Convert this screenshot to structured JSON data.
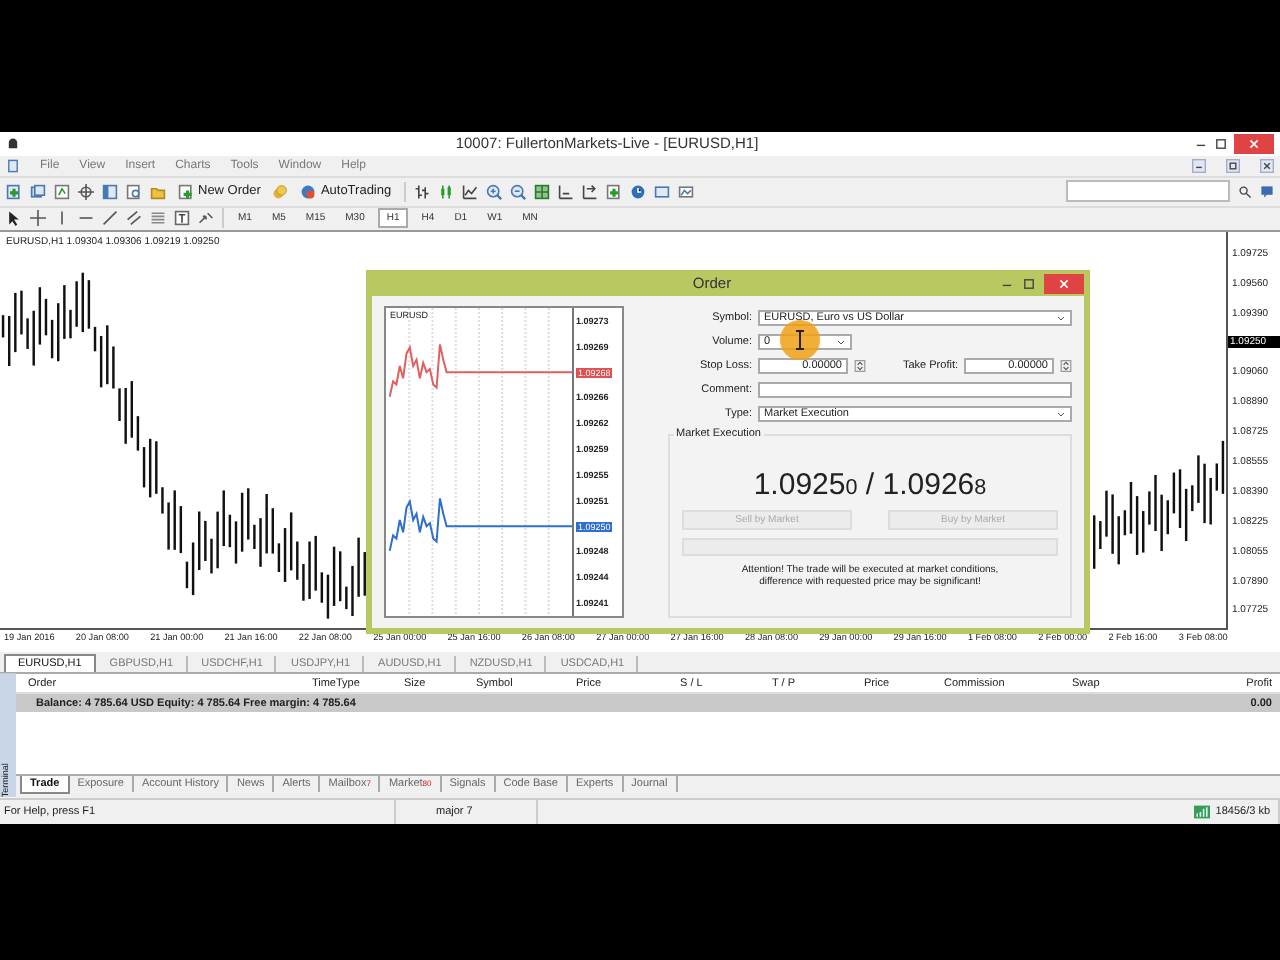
{
  "window": {
    "title": "10007: FullertonMarkets-Live - [EURUSD,H1]"
  },
  "menu": [
    "File",
    "View",
    "Insert",
    "Charts",
    "Tools",
    "Window",
    "Help"
  ],
  "toolbar": {
    "new_order": "New Order",
    "auto_trading": "AutoTrading"
  },
  "timeframes": [
    {
      "label": "M1",
      "selected": false
    },
    {
      "label": "M5",
      "selected": false
    },
    {
      "label": "M15",
      "selected": false
    },
    {
      "label": "M30",
      "selected": false
    },
    {
      "label": "H1",
      "selected": true
    },
    {
      "label": "H4",
      "selected": false
    },
    {
      "label": "D1",
      "selected": false
    },
    {
      "label": "W1",
      "selected": false
    },
    {
      "label": "MN",
      "selected": false
    }
  ],
  "chart": {
    "title": "EURUSD,H1  1.09304 1.09306 1.09219 1.09250",
    "price_labels": [
      {
        "text": "1.09725",
        "kind": "grid"
      },
      {
        "text": "1.09560",
        "kind": "grid"
      },
      {
        "text": "1.09390",
        "kind": "grid"
      },
      {
        "text": "1.09250",
        "kind": "current"
      },
      {
        "text": "1.09060",
        "kind": "grid"
      },
      {
        "text": "1.08890",
        "kind": "grid"
      },
      {
        "text": "1.08725",
        "kind": "grid"
      },
      {
        "text": "1.08555",
        "kind": "grid"
      },
      {
        "text": "1.08390",
        "kind": "grid"
      },
      {
        "text": "1.08225",
        "kind": "grid"
      },
      {
        "text": "1.08055",
        "kind": "grid"
      },
      {
        "text": "1.07890",
        "kind": "grid"
      },
      {
        "text": "1.07725",
        "kind": "grid"
      }
    ],
    "time_labels": [
      "19 Jan 2016",
      "20 Jan 08:00",
      "21 Jan 00:00",
      "21 Jan 16:00",
      "22 Jan 08:00",
      "25 Jan 00:00",
      "25 Jan 16:00",
      "26 Jan 08:00",
      "27 Jan 00:00",
      "27 Jan 16:00",
      "28 Jan 08:00",
      "29 Jan 00:00",
      "29 Jan 16:00",
      "1 Feb 08:00",
      "2 Feb 00:00",
      "2 Feb 16:00",
      "3 Feb 08:00"
    ]
  },
  "chart_tabs": [
    {
      "label": "EURUSD,H1",
      "selected": true
    },
    {
      "label": "GBPUSD,H1",
      "selected": false
    },
    {
      "label": "USDCHF,H1",
      "selected": false
    },
    {
      "label": "USDJPY,H1",
      "selected": false
    },
    {
      "label": "AUDUSD,H1",
      "selected": false
    },
    {
      "label": "NZDUSD,H1",
      "selected": false
    },
    {
      "label": "USDCAD,H1",
      "selected": false
    }
  ],
  "order_dialog": {
    "title": "Order",
    "tick_chart": {
      "symbol": "EURUSD",
      "price_labels": [
        {
          "text": "1.09273",
          "kind": "tick"
        },
        {
          "text": "1.09269",
          "kind": "tick"
        },
        {
          "text": "1.09268",
          "kind": "ask"
        },
        {
          "text": "1.09266",
          "kind": "tick"
        },
        {
          "text": "1.09262",
          "kind": "tick"
        },
        {
          "text": "1.09259",
          "kind": "tick"
        },
        {
          "text": "1.09255",
          "kind": "tick"
        },
        {
          "text": "1.09251",
          "kind": "tick"
        },
        {
          "text": "1.09250",
          "kind": "bid"
        },
        {
          "text": "1.09248",
          "kind": "tick"
        },
        {
          "text": "1.09244",
          "kind": "tick"
        },
        {
          "text": "1.09241",
          "kind": "tick"
        }
      ]
    },
    "symbol": {
      "label": "Symbol:",
      "value": "EURUSD, Euro vs US Dollar"
    },
    "volume": {
      "label": "Volume:",
      "value": "0"
    },
    "stop_loss": {
      "label": "Stop Loss:",
      "value": "0.00000"
    },
    "take_profit": {
      "label": "Take Profit:",
      "value": "0.00000"
    },
    "comment": {
      "label": "Comment:"
    },
    "type": {
      "label": "Type:",
      "value": "Market Execution"
    },
    "group_title": "Market Execution",
    "quote": "1.0925$_{0}$ / 1.0926$_{8}$",
    "buttons": [
      {
        "label": "Sell by Market",
        "disabled": true
      },
      {
        "label": "Buy by Market",
        "disabled": true
      }
    ],
    "notice": "Attention! The trade will be executed at market conditions, difference with requested price may be significant!"
  },
  "terminal": {
    "side_label": "Terminal",
    "columns": [
      "Order",
      "Time",
      "Type",
      "Size",
      "Symbol",
      "Price",
      "S / L",
      "T / P",
      "Price",
      "Commission",
      "Swap",
      "Profit"
    ],
    "balance": "Balance: 4 785.64 USD  Equity: 4 785.64  Free margin: 4 785.64",
    "profit": "0.00",
    "tabs": [
      {
        "label": "Trade",
        "selected": true
      },
      {
        "label": "Exposure",
        "selected": false
      },
      {
        "label": "Account History",
        "selected": false
      },
      {
        "label": "News",
        "selected": false
      },
      {
        "label": "Alerts",
        "selected": false
      },
      {
        "label": "Mailbox",
        "badge": "7",
        "selected": false
      },
      {
        "label": "Market",
        "badge": "80",
        "selected": false
      },
      {
        "label": "Signals",
        "selected": false
      },
      {
        "label": "Code Base",
        "selected": false
      },
      {
        "label": "Experts",
        "selected": false
      },
      {
        "label": "Journal",
        "selected": false
      }
    ]
  },
  "status_bar": {
    "help": "For Help, press F1",
    "profile": "major 7",
    "traffic": "18456/3 kb"
  }
}
